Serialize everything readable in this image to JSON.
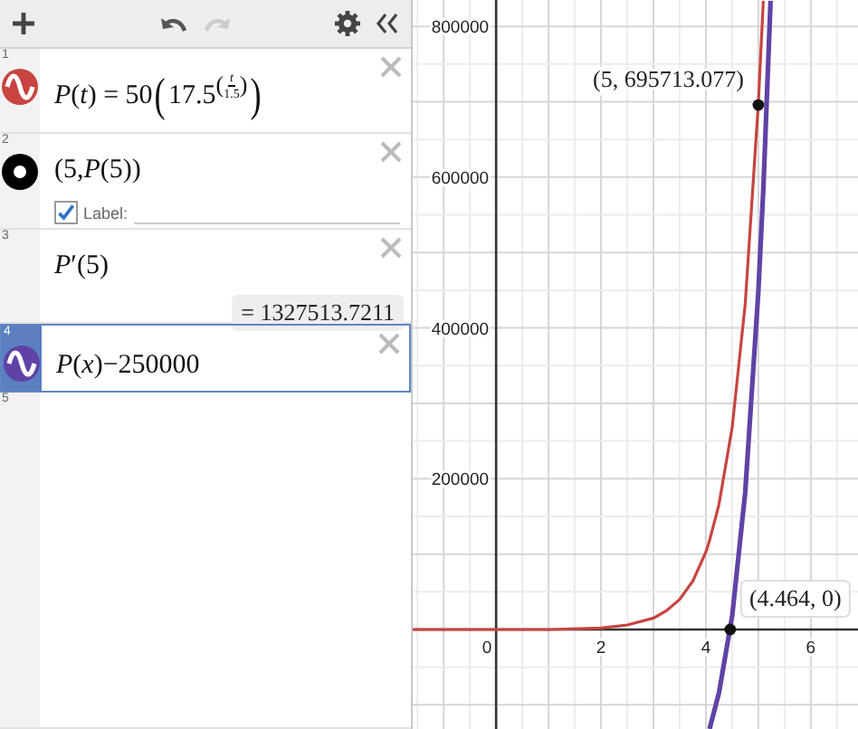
{
  "toolbar": {
    "redo_disabled": true
  },
  "expressions": [
    {
      "number": "1",
      "kind": "function",
      "color": "#c74440",
      "selected": false,
      "tokens": [
        {
          "kind": "text",
          "text": "*P*(*t*) = 50"
        },
        {
          "kind": "bigparen",
          "text": "("
        },
        {
          "kind": "power",
          "base": "17.5",
          "open": "(",
          "numerator": "*t*",
          "denominator": "1.5",
          "close": ")"
        },
        {
          "kind": "bigparen",
          "text": ")"
        }
      ]
    },
    {
      "number": "2",
      "kind": "point",
      "selected": false,
      "tokens": [
        {
          "kind": "text",
          "text": "(5,*P*(5))"
        }
      ],
      "label": {
        "checked": true,
        "text": "Label:"
      }
    },
    {
      "number": "3",
      "kind": "expression",
      "selected": false,
      "tokens": [
        {
          "kind": "text",
          "text": "*P*′(5)"
        }
      ],
      "result": "= 1327513.7211"
    },
    {
      "number": "4",
      "kind": "function",
      "color": "#6042a6",
      "selected": true,
      "tokens": [
        {
          "kind": "text",
          "text": "*P*(*x*)−250000"
        }
      ]
    },
    {
      "number": "5",
      "kind": "empty",
      "selected": false
    }
  ],
  "graph": {
    "chart_data": {
      "type": "line",
      "grid": true,
      "xlim": [
        -1.59,
        6.9
      ],
      "ylim": [
        -132000,
        835000
      ],
      "xticks": [
        0,
        2,
        4,
        6
      ],
      "yticks": [
        200000,
        400000,
        600000,
        800000
      ],
      "x": [
        -1.59,
        -1,
        0,
        1,
        2,
        2.5,
        3,
        3.25,
        3.5,
        3.75,
        4,
        4.07,
        4.25,
        4.5,
        4.75,
        5,
        5.095,
        5.233
      ],
      "series": [
        {
          "color": "#c74440",
          "values": [
            0,
            0,
            0,
            0,
            2000,
            6000,
            15000,
            25000,
            40000,
            64000,
            103000,
            118000,
            166000,
            268000,
            432000,
            696000,
            834000,
            null
          ]
        },
        {
          "color": "#6042a6",
          "values": [
            null,
            null,
            null,
            null,
            null,
            null,
            null,
            null,
            null,
            null,
            null,
            -132000,
            -84000,
            18000,
            182000,
            446000,
            584000,
            834000
          ]
        }
      ],
      "annotations": [
        {
          "x": 5,
          "y": 695713.077,
          "text": "(5, 695713.077)"
        },
        {
          "x": 4.464,
          "y": 0,
          "text": "(4.464, 0)"
        }
      ]
    },
    "labels": [
      {
        "boxed": false
      },
      {
        "boxed": true
      }
    ]
  }
}
